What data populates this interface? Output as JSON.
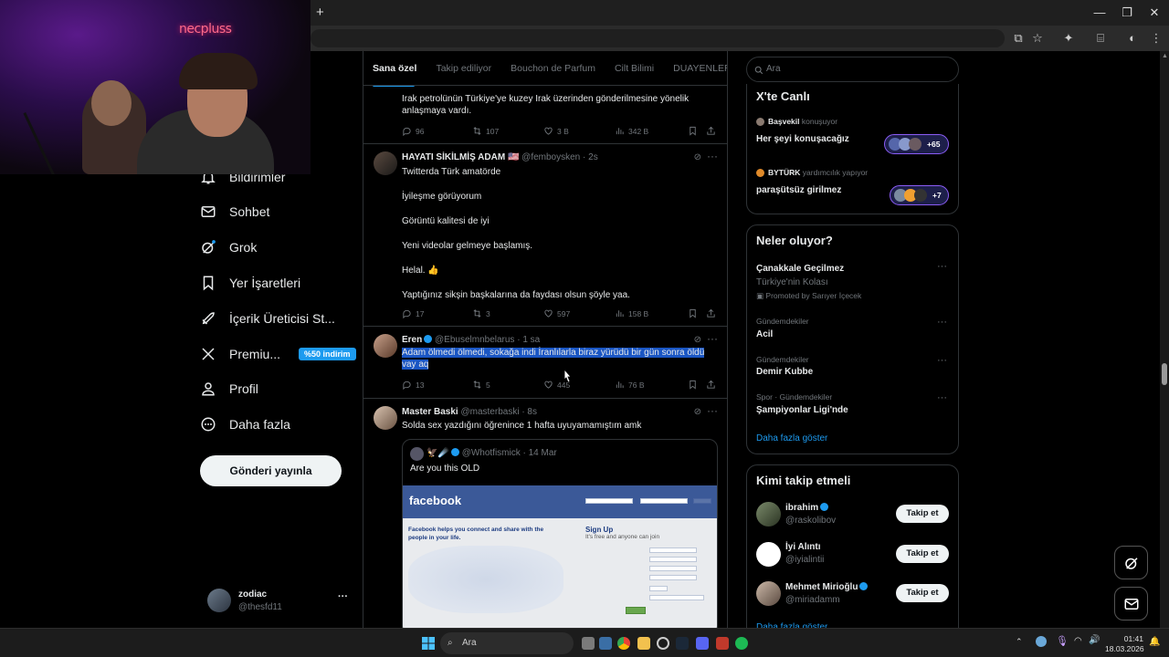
{
  "webcam": {
    "logo_text": "necpluss"
  },
  "browser": {
    "new_tab_glyph": "+",
    "min_glyph": "—",
    "max_glyph": "❐",
    "close_glyph": "✕"
  },
  "nav": {
    "items": [
      {
        "label": "Bildirimler",
        "icon": "bell-icon"
      },
      {
        "label": "Sohbet",
        "icon": "mail-icon"
      },
      {
        "label": "Grok",
        "icon": "grok-icon"
      },
      {
        "label": "Yer İşaretleri",
        "icon": "bookmark-icon"
      },
      {
        "label": "İçerik Üreticisi St...",
        "icon": "rocket-icon"
      },
      {
        "label": "Premiu...",
        "icon": "x-icon",
        "badge": "%50 indirim"
      },
      {
        "label": "Profil",
        "icon": "person-icon"
      },
      {
        "label": "Daha fazla",
        "icon": "more-circle-icon"
      }
    ],
    "post_button": "Gönderi yayınla",
    "account": {
      "name": "zodiac",
      "handle": "@thesfd11",
      "more": "···"
    }
  },
  "feed": {
    "tabs": [
      "Sana özel",
      "Takip ediliyor",
      "Bouchon de Parfum",
      "Cilt Bilimi",
      "DUAYENLER"
    ],
    "posts": [
      {
        "text": "Irak petrolünün Türkiye'ye kuzey Irak üzerinden gönderilmesine yönelik anlaşmaya vardı.",
        "replies": "96",
        "reposts": "107",
        "likes": "3 B",
        "views": "342 B"
      },
      {
        "name": "HAYATI SİKİLMİŞ ADAM 🇺🇸",
        "handle": "@femboysken · 2s",
        "lines": [
          "Twitterda Türk amatörde",
          "İyileşme görüyorum",
          "Görüntü kalitesi de iyi",
          "Yeni videolar gelmeye başlamış.",
          "Helal. 👍",
          "Yaptığınız sikşin başkalarına da faydası olsun şöyle yaa."
        ],
        "replies": "17",
        "reposts": "3",
        "likes": "597",
        "views": "158 B"
      },
      {
        "name": "Eren",
        "handle": "@Ebuselmnbelarus · 1 sa",
        "text_line1": "Adam ölmedi ölmedi, sokağa indi İranlılarla biraz yürüdü bir gün sonra öldü",
        "text_line2": "vay aq",
        "replies": "13",
        "reposts": "5",
        "likes": "445",
        "views": "76 B"
      },
      {
        "name": "Master Baski",
        "handle": "@masterbaski · 8s",
        "text": "Solda sex yazdığını öğrenince 1 hafta uyuyamamıştım amk",
        "quote": {
          "name": "🦅☄️",
          "handle": "@Whotfismick · 14 Mar",
          "text": "Are you this OLD",
          "fb_logo": "facebook",
          "fb_tagline": "Facebook helps you connect and share with the people in your life.",
          "fb_signup": "Sign Up",
          "fb_signup_sub": "It's free and anyone can join"
        }
      }
    ]
  },
  "sidebar": {
    "search_placeholder": "Ara",
    "live": {
      "title": "X'te Canlı",
      "spaces": [
        {
          "host": "Başvekil",
          "status": "konuşuyor",
          "title": "Her şeyi konuşacağız",
          "count": "+65"
        },
        {
          "host": "BYTÜRK",
          "status": "yardımcılık yapıyor",
          "title": "paraşütsüz girilmez",
          "count": "+7"
        }
      ]
    },
    "trends": {
      "title": "Neler oluyor?",
      "items": [
        {
          "context": "",
          "name": "Çanakkale Geçilmez",
          "sub": "Türkiye'nin Kolası",
          "promo": "Promoted by Sarıyer İçecek"
        },
        {
          "context": "Gündemdekiler",
          "name": "Acil"
        },
        {
          "context": "Gündemdekiler",
          "name": "Demir Kubbe"
        },
        {
          "context": "Spor · Gündemdekiler",
          "name": "Şampiyonlar Ligi'nde"
        }
      ],
      "show_more": "Daha fazla göster"
    },
    "who_to_follow": {
      "title": "Kimi takip etmeli",
      "users": [
        {
          "name": "ibrahim",
          "handle": "@raskolibov",
          "button": "Takip et"
        },
        {
          "name": "İyi Alıntı",
          "handle": "@iyialintii",
          "button": "Takip et"
        },
        {
          "name": "Mehmet Mirioğlu",
          "handle": "@miriadamm",
          "button": "Takip et"
        }
      ],
      "show_more": "Daha fazla göster"
    }
  },
  "taskbar": {
    "search": "Ara",
    "time": "01:41",
    "date": "18.03.2026"
  },
  "colors": {
    "accent": "#1d9bf0",
    "highlight": "#1a56c4",
    "bg": "#000000",
    "border": "#2f3336"
  }
}
